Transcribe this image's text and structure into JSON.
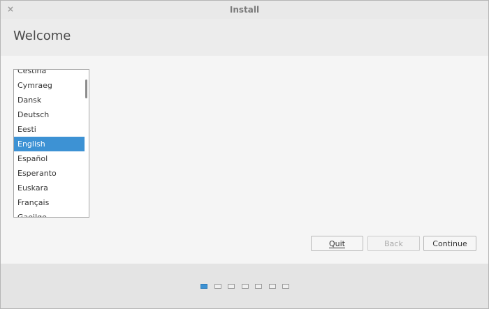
{
  "window": {
    "title": "Install",
    "close_glyph": "×"
  },
  "header": {
    "title": "Welcome"
  },
  "language_list": {
    "items": [
      "Čeština",
      "Cymraeg",
      "Dansk",
      "Deutsch",
      "Eesti",
      "English",
      "Español",
      "Esperanto",
      "Euskara",
      "Français",
      "Gaeilge"
    ],
    "selected": "English"
  },
  "buttons": {
    "quit": "Quit",
    "back": "Back",
    "continue": "Continue"
  },
  "progress": {
    "total_steps": 7,
    "current_step": 1
  },
  "colors": {
    "accent": "#3d92d4"
  }
}
